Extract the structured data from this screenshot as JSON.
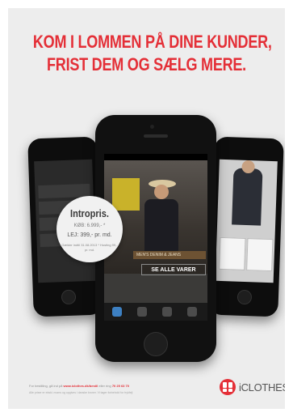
{
  "headline": {
    "line1": "KOM I LOMMEN PÅ DINE KUNDER,",
    "line2": "FRIST DEM OG SÆLG MERE."
  },
  "price_badge": {
    "title": "Intropris.",
    "line1": "KØB: 6.999,- *",
    "line2": "LEJ: 399,- pr. md.",
    "note": "Gælder indtil 31.08.2013 * Hosting 99,- pr. md."
  },
  "app_screen": {
    "shelf_label": "MEN'S DENIM & JEANS",
    "see_all_button": "SE ALLE VARER"
  },
  "footer": {
    "order_text_prefix": "For bestilling, gå ind på",
    "order_url": "www.iclothes.dk/bestil",
    "order_text_middle": "eller ring",
    "order_phone": "70 25 63 70",
    "fine_print": "Alle priser er ekskl. moms og opgives i danske kroner. Vi tager forbehold for trykfejl"
  },
  "brand": {
    "name": "iCLOTHES",
    "accent_color": "#e42f37"
  }
}
